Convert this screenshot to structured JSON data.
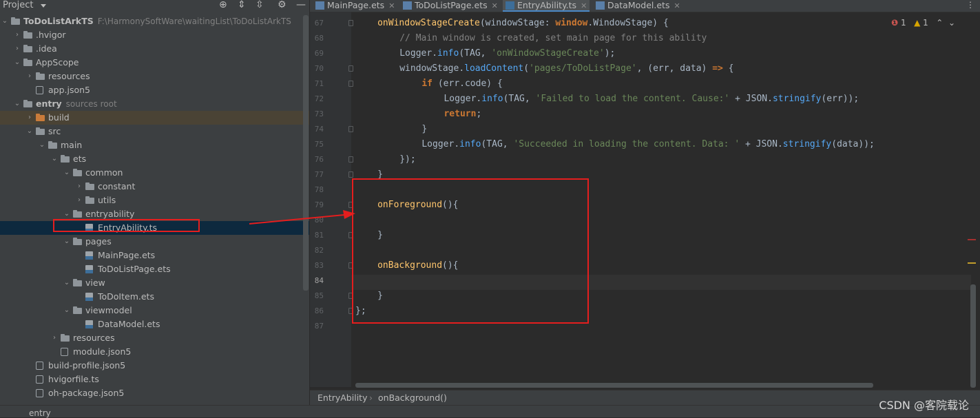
{
  "project_panel": {
    "title": "Project",
    "tree": [
      {
        "label": "ToDoListArkTS",
        "meta": "F:\\HarmonySoftWare\\waitingList\\ToDoListArkTS",
        "bold": true,
        "icon": "folder-icon",
        "expanded": true
      },
      {
        "label": ".hvigor",
        "icon": "folder-icon",
        "expanded": false
      },
      {
        "label": ".idea",
        "icon": "folder-icon",
        "expanded": false
      },
      {
        "label": "AppScope",
        "icon": "folder-icon",
        "expanded": true
      },
      {
        "label": "resources",
        "icon": "folder-icon",
        "expanded": false
      },
      {
        "label": "app.json5",
        "icon": "config-file-icon"
      },
      {
        "label": "entry",
        "meta": "sources root",
        "bold": true,
        "icon": "folder-icon",
        "expanded": true
      },
      {
        "label": "build",
        "icon": "excluded-folder-icon",
        "expanded": false
      },
      {
        "label": "src",
        "icon": "folder-icon",
        "expanded": true
      },
      {
        "label": "main",
        "icon": "folder-icon",
        "expanded": true
      },
      {
        "label": "ets",
        "icon": "folder-icon",
        "expanded": true
      },
      {
        "label": "common",
        "icon": "folder-icon",
        "expanded": true
      },
      {
        "label": "constant",
        "icon": "folder-icon",
        "expanded": false
      },
      {
        "label": "utils",
        "icon": "folder-icon",
        "expanded": false
      },
      {
        "label": "entryability",
        "icon": "folder-icon",
        "expanded": true
      },
      {
        "label": "EntryAbility.ts",
        "icon": "ts-file-icon",
        "selected": true
      },
      {
        "label": "pages",
        "icon": "folder-icon",
        "expanded": true
      },
      {
        "label": "MainPage.ets",
        "icon": "ets-file-icon"
      },
      {
        "label": "ToDoListPage.ets",
        "icon": "ets-file-icon"
      },
      {
        "label": "view",
        "icon": "folder-icon",
        "expanded": true
      },
      {
        "label": "ToDoItem.ets",
        "icon": "ets-file-icon"
      },
      {
        "label": "viewmodel",
        "icon": "folder-icon",
        "expanded": true
      },
      {
        "label": "DataModel.ets",
        "icon": "ets-file-icon"
      },
      {
        "label": "resources",
        "icon": "folder-icon",
        "expanded": false
      },
      {
        "label": "module.json5",
        "icon": "config-file-icon"
      },
      {
        "label": "build-profile.json5",
        "icon": "config-file-icon"
      },
      {
        "label": "hvigorfile.ts",
        "icon": "config-file-icon"
      },
      {
        "label": "oh-package.json5",
        "icon": "config-file-icon"
      }
    ]
  },
  "tabs": [
    {
      "label": "MainPage.ets",
      "icon": "ets-file-icon"
    },
    {
      "label": "ToDoListPage.ets",
      "icon": "ets-file-icon"
    },
    {
      "label": "EntryAbility.ts",
      "icon": "ts-file-icon",
      "active": true
    },
    {
      "label": "DataModel.ets",
      "icon": "ets-file-icon"
    }
  ],
  "inspection": {
    "errors": "1",
    "warnings": "1"
  },
  "code": {
    "current_line": 84,
    "lines": [
      {
        "n": 67,
        "text": "  onWindowStageCreate(windowStage: window.WindowStage) {"
      },
      {
        "n": 68,
        "text": "    // Main window is created, set main page for this ability"
      },
      {
        "n": 69,
        "text": "    Logger.info(TAG, 'onWindowStageCreate');"
      },
      {
        "n": 70,
        "text": "    windowStage.loadContent('pages/ToDoListPage', (err, data) => {"
      },
      {
        "n": 71,
        "text": "      if (err.code) {"
      },
      {
        "n": 72,
        "text": "        Logger.info(TAG, 'Failed to load the content. Cause:' + JSON.stringify(err));"
      },
      {
        "n": 73,
        "text": "        return;"
      },
      {
        "n": 74,
        "text": "      }"
      },
      {
        "n": 75,
        "text": "      Logger.info(TAG, 'Succeeded in loading the content. Data: ' + JSON.stringify(data));"
      },
      {
        "n": 76,
        "text": "    });"
      },
      {
        "n": 77,
        "text": "  }"
      },
      {
        "n": 78,
        "text": ""
      },
      {
        "n": 79,
        "text": "  onForeground(){"
      },
      {
        "n": 80,
        "text": ""
      },
      {
        "n": 81,
        "text": "  }"
      },
      {
        "n": 82,
        "text": ""
      },
      {
        "n": 83,
        "text": "  onBackground(){"
      },
      {
        "n": 84,
        "text": ""
      },
      {
        "n": 85,
        "text": "  }"
      },
      {
        "n": 86,
        "text": "};"
      },
      {
        "n": 87,
        "text": ""
      }
    ]
  },
  "breadcrumb": [
    "EntryAbility",
    "onBackground()"
  ],
  "bottom": {
    "label": "entry"
  },
  "watermark": "CSDN @客院载论",
  "colors": {
    "annotation_red": "#e51e1e",
    "selection": "#0d293e",
    "keyword": "#cc7832",
    "string": "#6a8759",
    "function": "#ffc66d"
  }
}
